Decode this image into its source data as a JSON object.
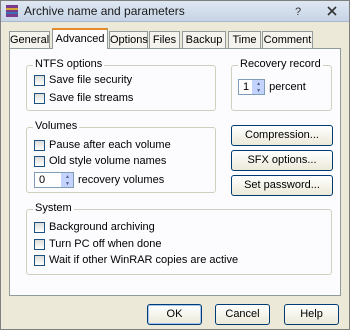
{
  "window": {
    "title": "Archive name and parameters"
  },
  "tabs": [
    "General",
    "Advanced",
    "Options",
    "Files",
    "Backup",
    "Time",
    "Comment"
  ],
  "ntfs": {
    "title": "NTFS options",
    "items": [
      "Save file security",
      "Save file streams"
    ]
  },
  "recovery_record": {
    "title": "Recovery record",
    "value": "1",
    "unit": "percent"
  },
  "volumes": {
    "title": "Volumes",
    "items": [
      "Pause after each volume",
      "Old style volume names"
    ],
    "recovery_value": "0",
    "recovery_label": "recovery volumes"
  },
  "side_buttons": [
    "Compression...",
    "SFX options...",
    "Set password..."
  ],
  "system": {
    "title": "System",
    "items": [
      "Background archiving",
      "Turn PC off when done",
      "Wait if other WinRAR copies are active"
    ]
  },
  "buttons": {
    "ok": "OK",
    "cancel": "Cancel",
    "help": "Help"
  },
  "colors": {
    "accent_tab": "#e68b2c",
    "button_border": "#003c74",
    "panel_bg": "#fcfcfe",
    "dialog_bg": "#ece9d8"
  }
}
